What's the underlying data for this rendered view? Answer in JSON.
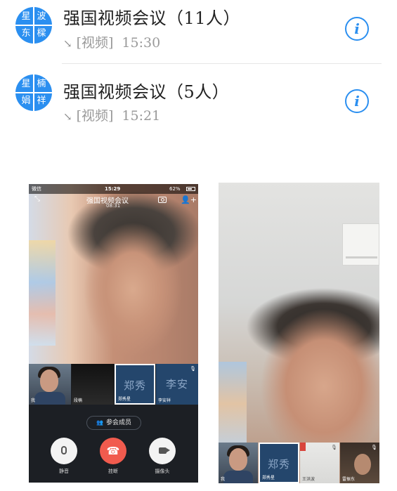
{
  "calls": [
    {
      "avatar_chars": [
        "星",
        "波",
        "东",
        "樑"
      ],
      "title": "强国视频会议（11人）",
      "call_type": "[视频]",
      "time": "15:30"
    },
    {
      "avatar_chars": [
        "星",
        "楠",
        "娟",
        "祥"
      ],
      "title": "强国视频会议（5人）",
      "call_type": "[视频]",
      "time": "15:21"
    }
  ],
  "screenshot1": {
    "status": {
      "carrier": "微信",
      "clock": "15:29",
      "battery": "62%"
    },
    "header": {
      "title": "强国视频会议",
      "timer": "08:31"
    },
    "thumbs": [
      {
        "label": "我"
      },
      {
        "label": "段楠"
      },
      {
        "big": "郑秀",
        "label": "郑秀星"
      },
      {
        "big": "李安",
        "label": "李安祥"
      }
    ],
    "members_button": "参会成员",
    "controls": {
      "mute": "静音",
      "hangup": "挂断",
      "camera": "摄像头"
    }
  },
  "screenshot2": {
    "thumbs": [
      {
        "label": "我"
      },
      {
        "big": "郑秀",
        "label": "郑秀星"
      },
      {
        "label": "王洪波"
      },
      {
        "label": "雷振东"
      }
    ]
  },
  "colors": {
    "accent": "#2b8ff0",
    "hangup": "#f15b4e",
    "tile": "#24466c"
  },
  "icons": [
    "info-icon",
    "outgoing-call-icon",
    "microphone-icon",
    "hangup-icon",
    "camera-icon",
    "people-icon",
    "add-member-icon",
    "camera-flip-icon",
    "collapse-icon"
  ]
}
